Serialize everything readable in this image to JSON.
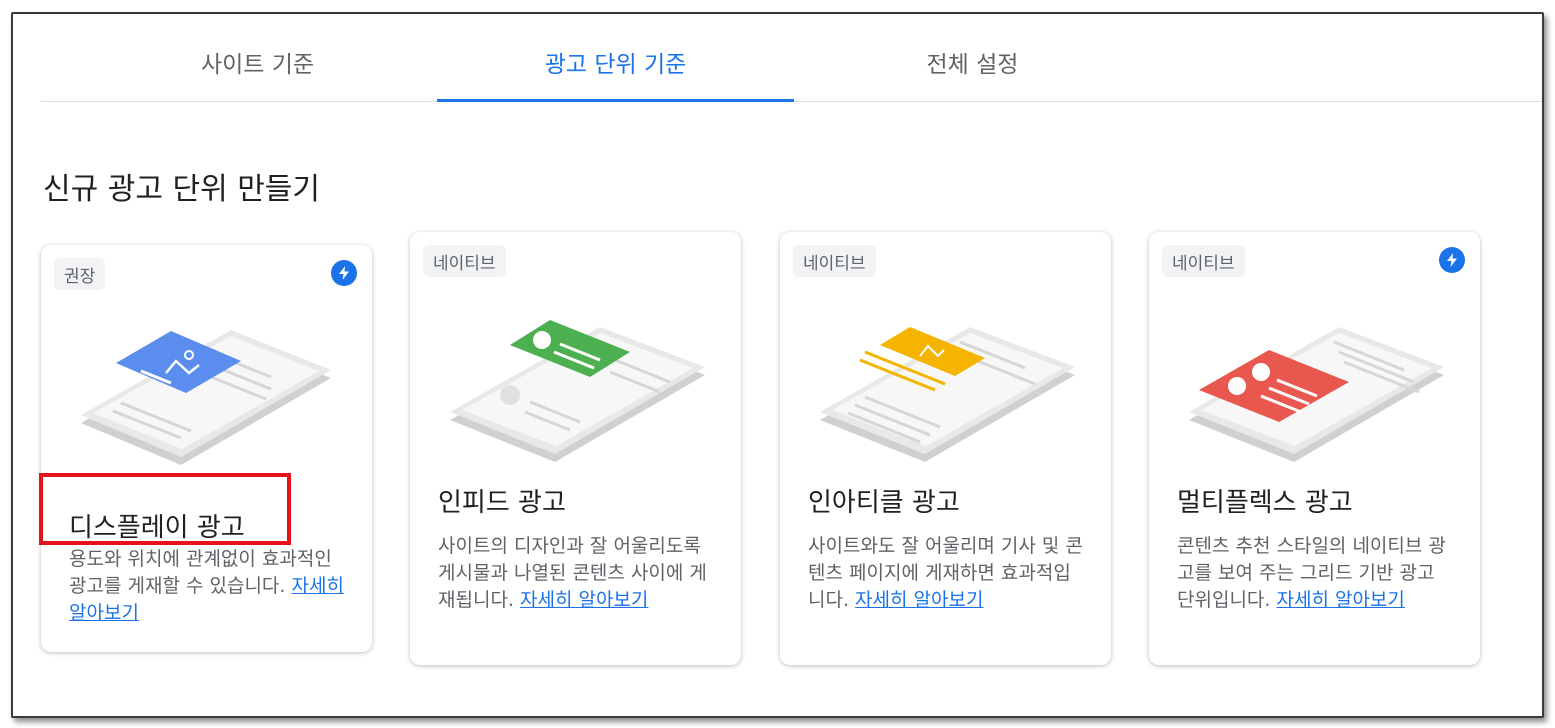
{
  "tabs": [
    {
      "label": "사이트 기준",
      "active": false
    },
    {
      "label": "광고 단위 기준",
      "active": true
    },
    {
      "label": "전체 설정",
      "active": false
    }
  ],
  "section_title": "신규 광고 단위 만들기",
  "colors": {
    "accent": "#1a73e8",
    "highlight": "#e5131a",
    "display": "#5b8def",
    "infeed": "#4caf50",
    "inarticle": "#f4b400",
    "multiplex": "#e8584e"
  },
  "cards": [
    {
      "chip": "권장",
      "has_bolt": true,
      "icon": "display-ad-illustration",
      "title": "디스플레이 광고",
      "desc": "용도와 위치에 관계없이 효과적인 광고를 게재할 수 있습니다. ",
      "link": "자세히 알아보기"
    },
    {
      "chip": "네이티브",
      "has_bolt": false,
      "icon": "infeed-ad-illustration",
      "title": "인피드 광고",
      "desc": "사이트의 디자인과 잘 어울리도록 게시물과 나열된 콘텐츠 사이에 게재됩니다. ",
      "link": "자세히 알아보기"
    },
    {
      "chip": "네이티브",
      "has_bolt": false,
      "icon": "inarticle-ad-illustration",
      "title": "인아티클 광고",
      "desc": "사이트와도 잘 어울리며 기사 및 콘텐츠 페이지에 게재하면 효과적입니다. ",
      "link": "자세히 알아보기"
    },
    {
      "chip": "네이티브",
      "has_bolt": true,
      "icon": "multiplex-ad-illustration",
      "title": "멀티플렉스 광고",
      "desc": "콘텐츠 추천 스타일의 네이티브 광고를 보여 주는 그리드 기반 광고 단위입니다. ",
      "link": "자세히 알아보기"
    }
  ]
}
